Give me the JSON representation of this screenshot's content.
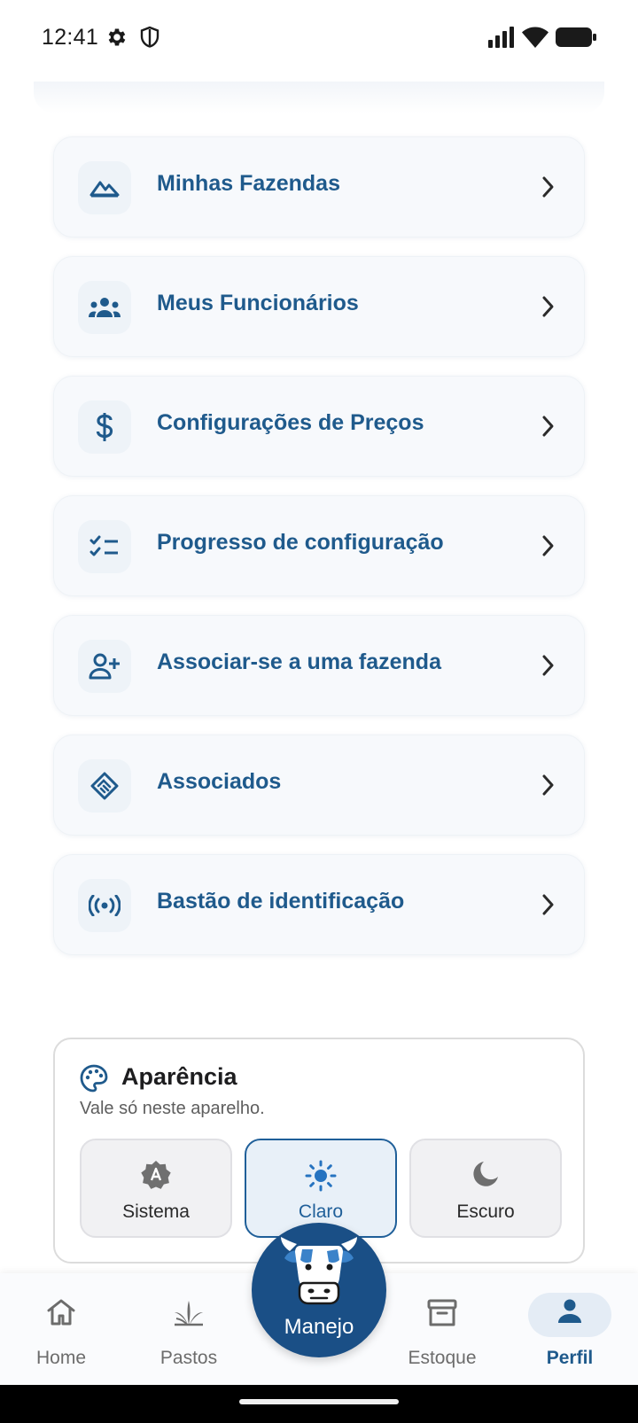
{
  "status_bar": {
    "time": "12:41",
    "icons": [
      "gear-icon",
      "shield-icon",
      "signal-icon",
      "wifi-icon",
      "battery-icon"
    ]
  },
  "menu": {
    "items": [
      {
        "label": "Minhas Fazendas",
        "icon": "farm-hills-icon"
      },
      {
        "label": "Meus Funcionários",
        "icon": "group-icon"
      },
      {
        "label": "Configurações de Preços",
        "icon": "dollar-icon"
      },
      {
        "label": "Progresso de configuração",
        "icon": "checklist-icon"
      },
      {
        "label": "Associar-se a uma fazenda",
        "icon": "person-add-icon"
      },
      {
        "label": "Associados",
        "icon": "handshake-icon"
      },
      {
        "label": "Bastão de identificação",
        "icon": "signal-broadcast-icon"
      }
    ]
  },
  "appearance": {
    "title": "Aparência",
    "subtitle": "Vale só neste aparelho.",
    "options": [
      {
        "label": "Sistema",
        "icon": "auto-theme-icon"
      },
      {
        "label": "Claro",
        "icon": "sun-icon"
      },
      {
        "label": "Escuro",
        "icon": "moon-icon"
      }
    ],
    "selected": "Claro"
  },
  "bottom_nav": {
    "home": "Home",
    "pastos": "Pastos",
    "fab": "Manejo",
    "estoque": "Estoque",
    "perfil": "Perfil",
    "active": "Perfil"
  },
  "colors": {
    "primary": "#1f5a8c",
    "fab": "#1a4f86",
    "card_bg": "#f7f9fc"
  }
}
